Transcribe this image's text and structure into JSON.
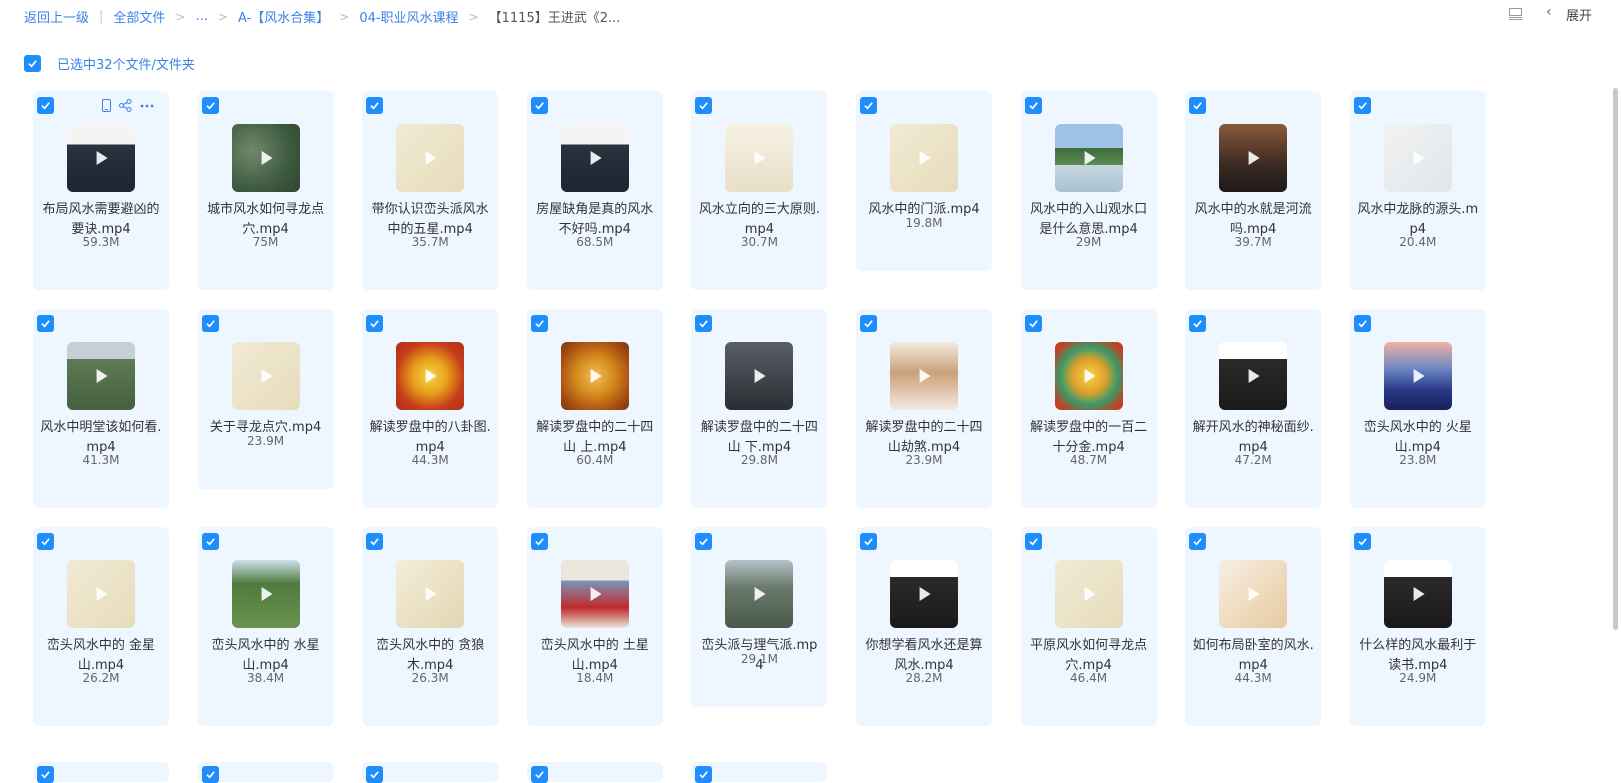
{
  "breadcrumb": {
    "back": "返回上一级",
    "all_files": "全部文件",
    "ellipsis": "...",
    "folder1": "A-【风水合集】",
    "folder2": "04-职业风水课程",
    "current": "【1115】王进武《2..."
  },
  "toolbar": {
    "expand_label": "展开"
  },
  "selection": {
    "text": "已选中32个文件/文件夹"
  },
  "files": [
    {
      "name": "布局风水需要避凶的要诀.mp4",
      "size": "59.3M",
      "thumb": "person"
    },
    {
      "name": "城市风水如何寻龙点穴.mp4",
      "size": "75M",
      "thumb": "aerial"
    },
    {
      "name": "带你认识峦头派风水中的五星.mp4",
      "size": "35.7M",
      "thumb": "paper"
    },
    {
      "name": "房屋缺角是真的风水不好吗.mp4",
      "size": "68.5M",
      "thumb": "person"
    },
    {
      "name": "风水立向的三大原则.mp4",
      "size": "30.7M",
      "thumb": "notes"
    },
    {
      "name": "风水中的门派.mp4",
      "size": "19.8M",
      "thumb": "paper"
    },
    {
      "name": "风水中的入山观水口是什么意思.mp4",
      "size": "29M",
      "thumb": "landscape"
    },
    {
      "name": "风水中的水就是河流吗.mp4",
      "size": "39.7M",
      "thumb": "portrait"
    },
    {
      "name": "风水中龙脉的源头.mp4",
      "size": "20.4M",
      "thumb": "map"
    },
    {
      "name": "风水中明堂该如何看.mp4",
      "size": "41.3M",
      "thumb": "village"
    },
    {
      "name": "关于寻龙点穴.mp4",
      "size": "23.9M",
      "thumb": "paper"
    },
    {
      "name": "解读罗盘中的八卦图.mp4",
      "size": "44.3M",
      "thumb": "compass"
    },
    {
      "name": "解读罗盘中的二十四山 上.mp4",
      "size": "60.4M",
      "thumb": "compass2"
    },
    {
      "name": "解读罗盘中的二十四山 下.mp4",
      "size": "29.8M",
      "thumb": "speaker"
    },
    {
      "name": "解读罗盘中的二十四山劫煞.mp4",
      "size": "23.9M",
      "thumb": "temple"
    },
    {
      "name": "解读罗盘中的一百二十分金.mp4",
      "size": "48.7M",
      "thumb": "compass3"
    },
    {
      "name": "解开风水的神秘面纱.mp4",
      "size": "47.2M",
      "thumb": "lecture"
    },
    {
      "name": "峦头风水中的 火星山.mp4",
      "size": "23.8M",
      "thumb": "mountain"
    },
    {
      "name": "峦头风水中的 金星山.mp4",
      "size": "26.2M",
      "thumb": "paper"
    },
    {
      "name": "峦头风水中的 水星山.mp4",
      "size": "38.4M",
      "thumb": "hills"
    },
    {
      "name": "峦头风水中的 贪狼木.mp4",
      "size": "26.3M",
      "thumb": "paper2"
    },
    {
      "name": "峦头风水中的 土星山.mp4",
      "size": "18.4M",
      "thumb": "building"
    },
    {
      "name": "峦头派与理气派.mp4",
      "size": "29.1M",
      "thumb": "estate"
    },
    {
      "name": "你想学看风水还是算风水.mp4",
      "size": "28.2M",
      "thumb": "lecture"
    },
    {
      "name": "平原风水如何寻龙点穴.mp4",
      "size": "46.4M",
      "thumb": "paper"
    },
    {
      "name": "如何布局卧室的风水.mp4",
      "size": "44.3M",
      "thumb": "floorplan"
    },
    {
      "name": "什么样的风水最利于读书.mp4",
      "size": "24.9M",
      "thumb": "lecture"
    }
  ],
  "colors": {
    "accent": "#1f8efa",
    "link": "#3a82e8",
    "card_bg": "#eef7ff"
  }
}
